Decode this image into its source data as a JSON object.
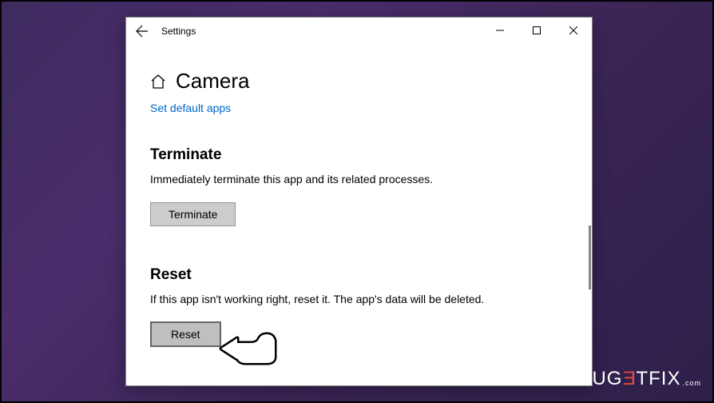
{
  "window": {
    "title": "Settings"
  },
  "page": {
    "title": "Camera",
    "default_apps_link": "Set default apps"
  },
  "sections": {
    "terminate": {
      "heading": "Terminate",
      "description": "Immediately terminate this app and its related processes.",
      "button_label": "Terminate"
    },
    "reset": {
      "heading": "Reset",
      "description": "If this app isn't working right, reset it. The app's data will be deleted.",
      "button_label": "Reset"
    }
  },
  "watermark": {
    "prefix": "UG",
    "e": "E",
    "suffix": "TFIX",
    "tld": ".com"
  }
}
